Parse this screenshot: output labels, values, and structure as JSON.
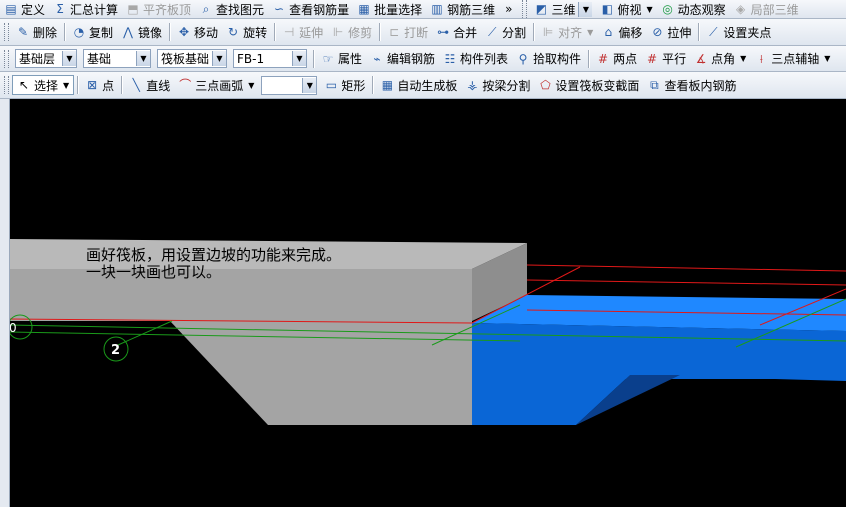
{
  "menu_bar": {
    "items": [
      {
        "label": "定义",
        "icon": "define-icon",
        "enabled": true
      },
      {
        "label": "汇总计算",
        "icon": "sigma-icon",
        "enabled": true
      },
      {
        "label": "平齐板顶",
        "icon": "align-top-icon",
        "enabled": false
      },
      {
        "label": "查找图元",
        "icon": "binoculars-icon",
        "enabled": true
      },
      {
        "label": "查看钢筋量",
        "icon": "rebar-qty-icon",
        "enabled": true
      },
      {
        "label": "批量选择",
        "icon": "batch-select-icon",
        "enabled": true
      },
      {
        "label": "钢筋三维",
        "icon": "rebar-3d-icon",
        "enabled": true
      }
    ],
    "overflow": "»",
    "view_mode": "三维",
    "view_angle": "俯视",
    "dynamic_observe": "动态观察",
    "local_3d": "局部三维"
  },
  "edit_toolbar": {
    "items": [
      {
        "label": "删除",
        "icon": "delete-icon",
        "enabled": true
      },
      {
        "label": "复制",
        "icon": "copy-icon",
        "enabled": true
      },
      {
        "label": "镜像",
        "icon": "mirror-icon",
        "enabled": true
      },
      {
        "label": "移动",
        "icon": "move-icon",
        "enabled": true
      },
      {
        "label": "旋转",
        "icon": "rotate-icon",
        "enabled": true
      },
      {
        "label": "延伸",
        "icon": "extend-icon",
        "enabled": false
      },
      {
        "label": "修剪",
        "icon": "trim-icon",
        "enabled": false
      },
      {
        "label": "打断",
        "icon": "break-icon",
        "enabled": false
      },
      {
        "label": "合并",
        "icon": "merge-icon",
        "enabled": true
      },
      {
        "label": "分割",
        "icon": "split-icon",
        "enabled": true
      },
      {
        "label": "对齐",
        "icon": "align-icon",
        "enabled": false
      },
      {
        "label": "偏移",
        "icon": "offset-icon",
        "enabled": true
      },
      {
        "label": "拉伸",
        "icon": "stretch-icon",
        "enabled": true
      },
      {
        "label": "设置夹点",
        "icon": "grip-point-icon",
        "enabled": true
      }
    ]
  },
  "component_toolbar": {
    "layer_select": "基础层",
    "type_select": "基础",
    "subtype_select": "筏板基础",
    "name_select": "FB-1",
    "items": [
      {
        "label": "属性",
        "icon": "properties-icon"
      },
      {
        "label": "编辑钢筋",
        "icon": "edit-rebar-icon"
      },
      {
        "label": "构件列表",
        "icon": "component-list-icon"
      },
      {
        "label": "拾取构件",
        "icon": "pick-component-icon"
      }
    ],
    "snap_items": [
      {
        "label": "两点",
        "icon": "two-point-axis-icon"
      },
      {
        "label": "平行",
        "icon": "parallel-axis-icon"
      },
      {
        "label": "点角",
        "icon": "point-angle-icon"
      },
      {
        "label": "三点辅轴",
        "icon": "three-point-axis-icon"
      }
    ]
  },
  "draw_toolbar": {
    "select": "选择",
    "point": "点",
    "line": "直线",
    "arc": "三点画弧",
    "blank_select": "",
    "rect": "矩形",
    "items": [
      {
        "label": "自动生成板",
        "icon": "auto-slab-icon"
      },
      {
        "label": "按梁分割",
        "icon": "split-by-beam-icon"
      },
      {
        "label": "设置筏板变截面",
        "icon": "variable-section-icon"
      },
      {
        "label": "查看板内钢筋",
        "icon": "view-slab-rebar-icon"
      }
    ]
  },
  "viewport": {
    "annotation_line1": "画好筏板，用设置边坡的功能来完成。",
    "annotation_line2": "一块一块画也可以。",
    "axis_marker_label": "2",
    "axis_marker_left": "0",
    "colors": {
      "background": "#000000",
      "gray_top": "#b9b9b9",
      "gray_front": "#a4a4a4",
      "gray_dark": "#8e8e8e",
      "blue_top": "#1f88ff",
      "blue_front": "#0a66d6",
      "blue_dark": "#0a3f8c",
      "red_line": "#e01818",
      "green_line": "#1a9a1a"
    }
  }
}
